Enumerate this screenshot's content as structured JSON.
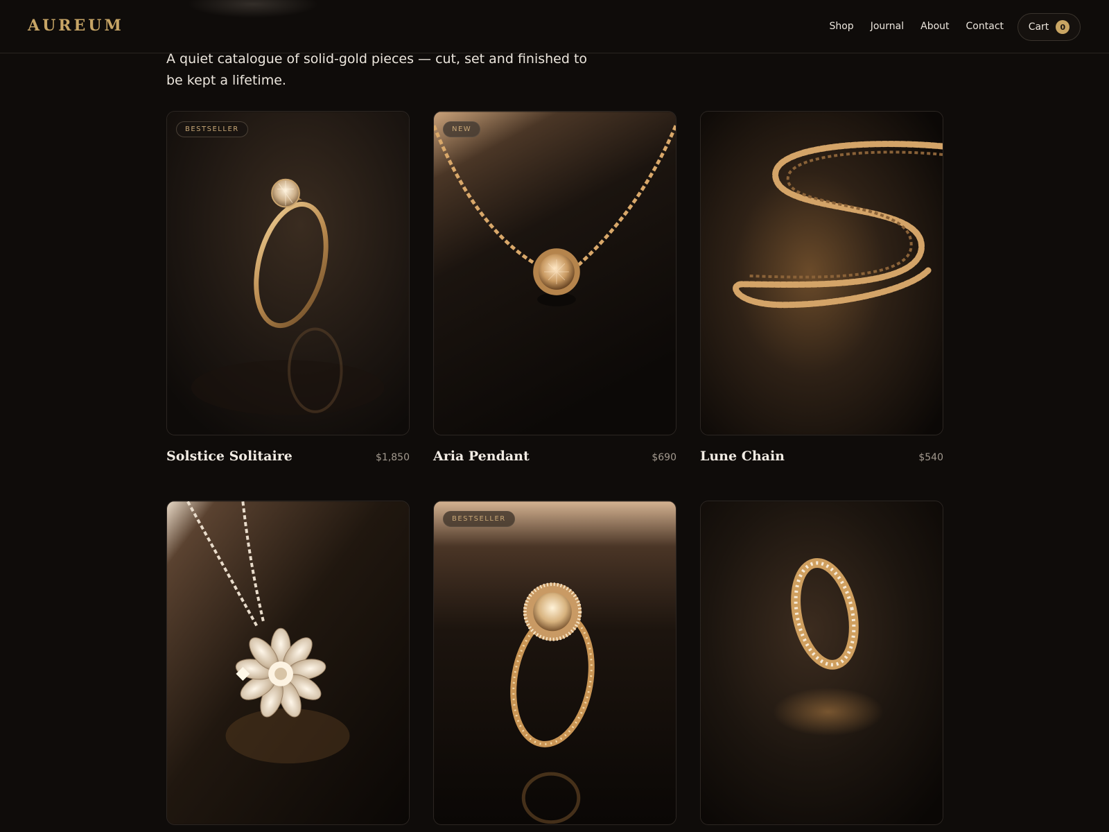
{
  "brand": {
    "logo": "AUREUM"
  },
  "nav": {
    "items": [
      "Shop",
      "Journal",
      "About",
      "Contact"
    ],
    "cart_label": "Cart",
    "cart_count": "0"
  },
  "intro": {
    "text": "A quiet catalogue of solid-gold pieces — cut, set and finished to be kept a lifetime."
  },
  "products": [
    {
      "name": "Solstice Solitaire",
      "price": "$1,850",
      "badge": "BESTSELLER",
      "image": "solitaire-ring-icon"
    },
    {
      "name": "Aria Pendant",
      "price": "$690",
      "badge": "NEW",
      "image": "bezel-pendant-icon"
    },
    {
      "name": "Lune Chain",
      "price": "$540",
      "badge": "",
      "image": "curb-chain-icon"
    },
    {
      "name": "",
      "price": "",
      "badge": "",
      "image": "flower-pendant-icon"
    },
    {
      "name": "",
      "price": "",
      "badge": "BESTSELLER",
      "image": "halo-ring-icon"
    },
    {
      "name": "",
      "price": "",
      "badge": "",
      "image": "eternity-band-icon"
    }
  ],
  "colors": {
    "background": "#0f0c0a",
    "accent": "#c7a566",
    "gold": "#d8ad6a"
  }
}
